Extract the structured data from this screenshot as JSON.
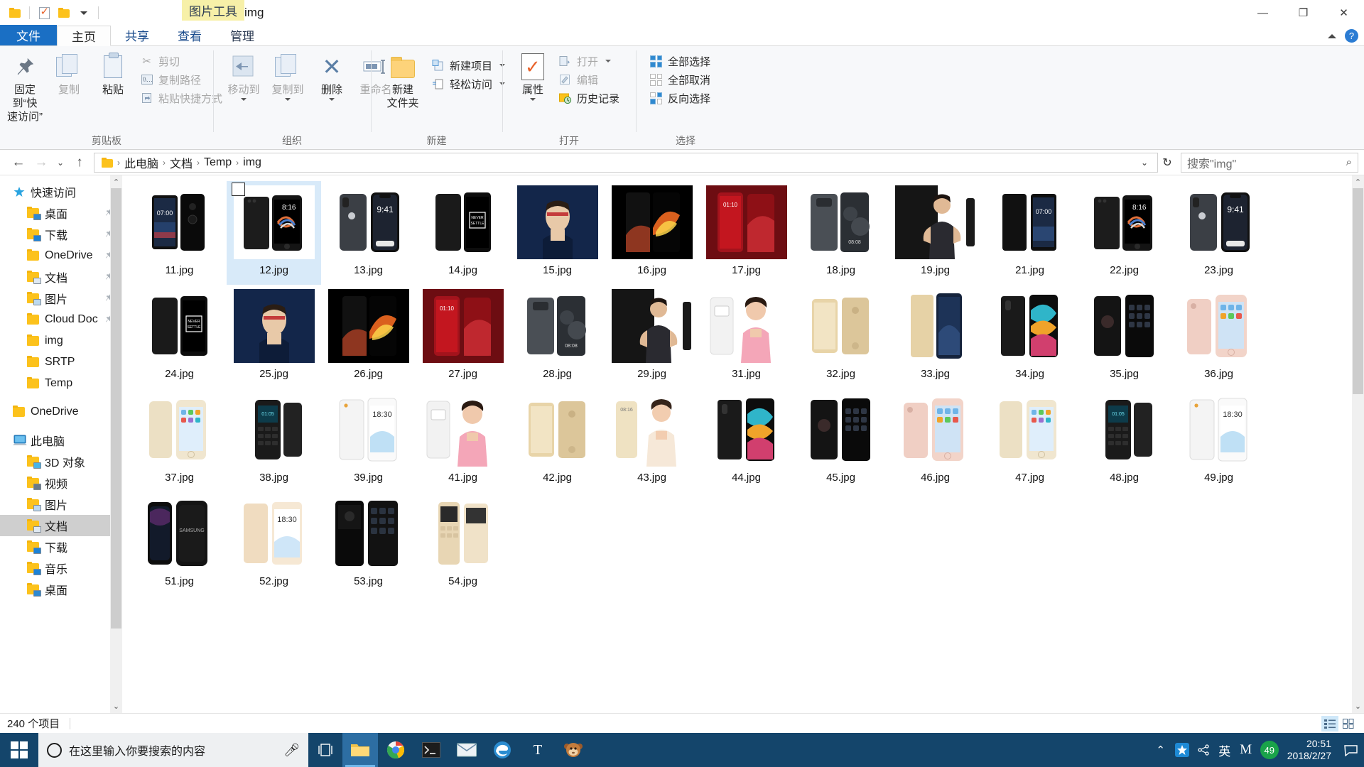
{
  "titlebar": {
    "quick_access": [
      "folder-icon",
      "properties-check-icon",
      "new-folder-icon",
      "customize-chevron-icon"
    ],
    "context_tab_group": "图片工具",
    "window_title": "img",
    "minimize": "—",
    "maximize": "❐",
    "close": "✕"
  },
  "tabs": [
    {
      "label": "文件",
      "state": "file"
    },
    {
      "label": "主页",
      "state": "active"
    },
    {
      "label": "共享",
      "state": "normal"
    },
    {
      "label": "查看",
      "state": "normal"
    },
    {
      "label": "管理",
      "state": "contextual"
    }
  ],
  "ribbon": {
    "help_label": "?",
    "groups": [
      {
        "label": "剪贴板",
        "big": [
          {
            "label": "固定到“快\n速访问”",
            "icon": "pin-icon",
            "dim": false
          },
          {
            "label": "复制",
            "icon": "copy-icon",
            "dim": true
          },
          {
            "label": "粘贴",
            "icon": "paste-icon",
            "dim": false
          }
        ],
        "small": [
          {
            "label": "剪切",
            "icon": "scissors-icon",
            "dim": true
          },
          {
            "label": "复制路径",
            "icon": "copy-path-icon",
            "dim": true
          },
          {
            "label": "粘贴快捷方式",
            "icon": "paste-shortcut-icon",
            "dim": true
          }
        ]
      },
      {
        "label": "组织",
        "big": [
          {
            "label": "移动到",
            "icon": "move-to-icon",
            "dim": true,
            "caret": true
          },
          {
            "label": "复制到",
            "icon": "copy-to-icon",
            "dim": true,
            "caret": true
          },
          {
            "label": "删除",
            "icon": "delete-x-icon",
            "dim": false,
            "caret": true
          },
          {
            "label": "重命名",
            "icon": "rename-icon",
            "dim": true
          }
        ],
        "small": []
      },
      {
        "label": "新建",
        "big": [
          {
            "label": "新建\n文件夹",
            "icon": "new-folder-icon",
            "dim": false
          }
        ],
        "small": [
          {
            "label": "新建项目",
            "icon": "new-item-icon",
            "dim": false,
            "caret": true
          },
          {
            "label": "轻松访问",
            "icon": "easy-access-icon",
            "dim": false,
            "caret": true
          }
        ]
      },
      {
        "label": "打开",
        "big": [
          {
            "label": "属性",
            "icon": "properties-icon",
            "dim": false,
            "caret": true
          }
        ],
        "small": [
          {
            "label": "打开",
            "icon": "open-icon",
            "dim": true,
            "caret": true
          },
          {
            "label": "编辑",
            "icon": "edit-icon",
            "dim": true
          },
          {
            "label": "历史记录",
            "icon": "history-icon",
            "dim": false
          }
        ]
      },
      {
        "label": "选择",
        "big": [],
        "small": [
          {
            "label": "全部选择",
            "icon": "select-all-icon",
            "dim": false
          },
          {
            "label": "全部取消",
            "icon": "select-none-icon",
            "dim": false
          },
          {
            "label": "反向选择",
            "icon": "invert-selection-icon",
            "dim": false
          }
        ]
      }
    ]
  },
  "addressbar": {
    "back": "←",
    "forward": "→",
    "recent": "⌄",
    "up": "↑",
    "crumbs": [
      "此电脑",
      "文档",
      "Temp",
      "img"
    ],
    "dropdown_caret": "⌄",
    "refresh": "↻",
    "search_placeholder": "搜索\"img\"",
    "search_icon": "search-icon"
  },
  "sidebar": {
    "items": [
      {
        "label": "快速访问",
        "icon": "quick-access-star-icon",
        "level": 0,
        "pinned": false,
        "selected": false
      },
      {
        "label": "桌面",
        "icon": "desktop-folder-icon",
        "level": 1,
        "pinned": true,
        "selected": false
      },
      {
        "label": "下载",
        "icon": "downloads-folder-icon",
        "level": 1,
        "pinned": true,
        "selected": false
      },
      {
        "label": "OneDrive",
        "icon": "folder-icon",
        "level": 1,
        "pinned": true,
        "selected": false
      },
      {
        "label": "文档",
        "icon": "documents-folder-icon",
        "level": 1,
        "pinned": true,
        "selected": false
      },
      {
        "label": "图片",
        "icon": "pictures-folder-icon",
        "level": 1,
        "pinned": true,
        "selected": false
      },
      {
        "label": "Cloud Doc",
        "icon": "folder-icon",
        "level": 1,
        "pinned": true,
        "selected": false
      },
      {
        "label": "img",
        "icon": "folder-icon",
        "level": 1,
        "pinned": false,
        "selected": false
      },
      {
        "label": "SRTP",
        "icon": "folder-icon",
        "level": 1,
        "pinned": false,
        "selected": false
      },
      {
        "label": "Temp",
        "icon": "folder-icon",
        "level": 1,
        "pinned": false,
        "selected": false
      },
      {
        "label": "OneDrive",
        "icon": "onedrive-folder-icon",
        "level": 0,
        "pinned": false,
        "selected": false,
        "spacer": true
      },
      {
        "label": "此电脑",
        "icon": "this-pc-icon",
        "level": 0,
        "pinned": false,
        "selected": false,
        "spacer": true
      },
      {
        "label": "3D 对象",
        "icon": "3d-objects-folder-icon",
        "level": 1,
        "pinned": false,
        "selected": false
      },
      {
        "label": "视频",
        "icon": "videos-folder-icon",
        "level": 1,
        "pinned": false,
        "selected": false
      },
      {
        "label": "图片",
        "icon": "pictures-folder-icon",
        "level": 1,
        "pinned": false,
        "selected": false
      },
      {
        "label": "文档",
        "icon": "documents-folder-icon",
        "level": 1,
        "pinned": false,
        "selected": true
      },
      {
        "label": "下载",
        "icon": "downloads-folder-icon",
        "level": 1,
        "pinned": false,
        "selected": false
      },
      {
        "label": "音乐",
        "icon": "music-folder-icon",
        "level": 1,
        "pinned": false,
        "selected": false
      },
      {
        "label": "桌面",
        "icon": "desktop-folder-icon",
        "level": 1,
        "pinned": false,
        "selected": false
      }
    ],
    "scroll_up": "⌃",
    "scroll_down": "⌄"
  },
  "files": [
    {
      "name": "11.jpg",
      "selected": false,
      "art": "nokia-black"
    },
    {
      "name": "12.jpg",
      "selected": true,
      "art": "mi-note3"
    },
    {
      "name": "13.jpg",
      "selected": false,
      "art": "iphone-x"
    },
    {
      "name": "14.jpg",
      "selected": false,
      "art": "oneplus-5t"
    },
    {
      "name": "15.jpg",
      "selected": false,
      "art": "honor-model"
    },
    {
      "name": "16.jpg",
      "selected": false,
      "art": "mi-mix2-flame"
    },
    {
      "name": "17.jpg",
      "selected": false,
      "art": "red-phone"
    },
    {
      "name": "18.jpg",
      "selected": false,
      "art": "mate10-grey"
    },
    {
      "name": "19.jpg",
      "selected": false,
      "art": "man-model"
    },
    {
      "name": "21.jpg",
      "selected": false,
      "art": "nokia-blue"
    },
    {
      "name": "22.jpg",
      "selected": false,
      "art": "mi-note3"
    },
    {
      "name": "23.jpg",
      "selected": false,
      "art": "iphone-x"
    },
    {
      "name": "24.jpg",
      "selected": false,
      "art": "oneplus-5t"
    },
    {
      "name": "25.jpg",
      "selected": false,
      "art": "honor-model"
    },
    {
      "name": "26.jpg",
      "selected": false,
      "art": "mi-mix2-flame"
    },
    {
      "name": "27.jpg",
      "selected": false,
      "art": "red-phone"
    },
    {
      "name": "28.jpg",
      "selected": false,
      "art": "mate10-grey"
    },
    {
      "name": "29.jpg",
      "selected": false,
      "art": "man-model"
    },
    {
      "name": "31.jpg",
      "selected": false,
      "art": "woman-pink"
    },
    {
      "name": "32.jpg",
      "selected": false,
      "art": "gold-phone"
    },
    {
      "name": "33.jpg",
      "selected": false,
      "art": "gold-tall"
    },
    {
      "name": "34.jpg",
      "selected": false,
      "art": "colorful-phone"
    },
    {
      "name": "35.jpg",
      "selected": false,
      "art": "black-android"
    },
    {
      "name": "36.jpg",
      "selected": false,
      "art": "rose-iphone"
    },
    {
      "name": "37.jpg",
      "selected": false,
      "art": "gold-iphone"
    },
    {
      "name": "38.jpg",
      "selected": false,
      "art": "nokia-feature"
    },
    {
      "name": "39.jpg",
      "selected": false,
      "art": "meizu-white"
    },
    {
      "name": "41.jpg",
      "selected": false,
      "art": "woman-pink"
    },
    {
      "name": "42.jpg",
      "selected": false,
      "art": "gold-phone"
    },
    {
      "name": "43.jpg",
      "selected": false,
      "art": "woman-gold"
    },
    {
      "name": "44.jpg",
      "selected": false,
      "art": "colorful-phone"
    },
    {
      "name": "45.jpg",
      "selected": false,
      "art": "black-android"
    },
    {
      "name": "46.jpg",
      "selected": false,
      "art": "rose-iphone"
    },
    {
      "name": "47.jpg",
      "selected": false,
      "art": "gold-iphone"
    },
    {
      "name": "48.jpg",
      "selected": false,
      "art": "nokia-feature"
    },
    {
      "name": "49.jpg",
      "selected": false,
      "art": "meizu-white"
    },
    {
      "name": "51.jpg",
      "selected": false,
      "art": "samsung-black"
    },
    {
      "name": "52.jpg",
      "selected": false,
      "art": "meizu-gold"
    },
    {
      "name": "53.jpg",
      "selected": false,
      "art": "black-stack"
    },
    {
      "name": "54.jpg",
      "selected": false,
      "art": "gold-feature"
    }
  ],
  "statusbar": {
    "item_count": "240 个项目",
    "view_large_icons": "large-icons-view-icon",
    "view_details": "details-view-icon"
  },
  "taskbar": {
    "start": "windows-logo-icon",
    "search_placeholder": "在这里输入你要搜索的内容",
    "cortana_icon": "cortana-circle-icon",
    "mic_icon": "microphone-icon",
    "taskview_icon": "task-view-icon",
    "apps": [
      {
        "name": "file-explorer",
        "glyph": "folder",
        "active": true
      },
      {
        "name": "chrome",
        "glyph": "chrome",
        "active": false
      },
      {
        "name": "terminal",
        "glyph": "terminal",
        "active": false
      },
      {
        "name": "mail",
        "glyph": "mail",
        "active": false
      },
      {
        "name": "edge",
        "glyph": "edge",
        "active": false
      },
      {
        "name": "typora",
        "glyph": "T",
        "active": false
      },
      {
        "name": "monkey-app",
        "glyph": "monkey",
        "active": false
      }
    ],
    "tray": {
      "show_hidden": "⌃",
      "icons": [
        "blue-star-icon",
        "share-icon"
      ],
      "ime": "英",
      "ime_mode": "M",
      "battery_badge": "49"
    },
    "time": "20:51",
    "date": "2018/2/27",
    "action_center": "notification-icon"
  },
  "colors": {
    "accent": "#1a6fc4",
    "taskbar": "#14456b",
    "selection": "#d8eaf9",
    "context_tab": "#f7f0a8",
    "folder_yellow": "#fcc21c"
  }
}
